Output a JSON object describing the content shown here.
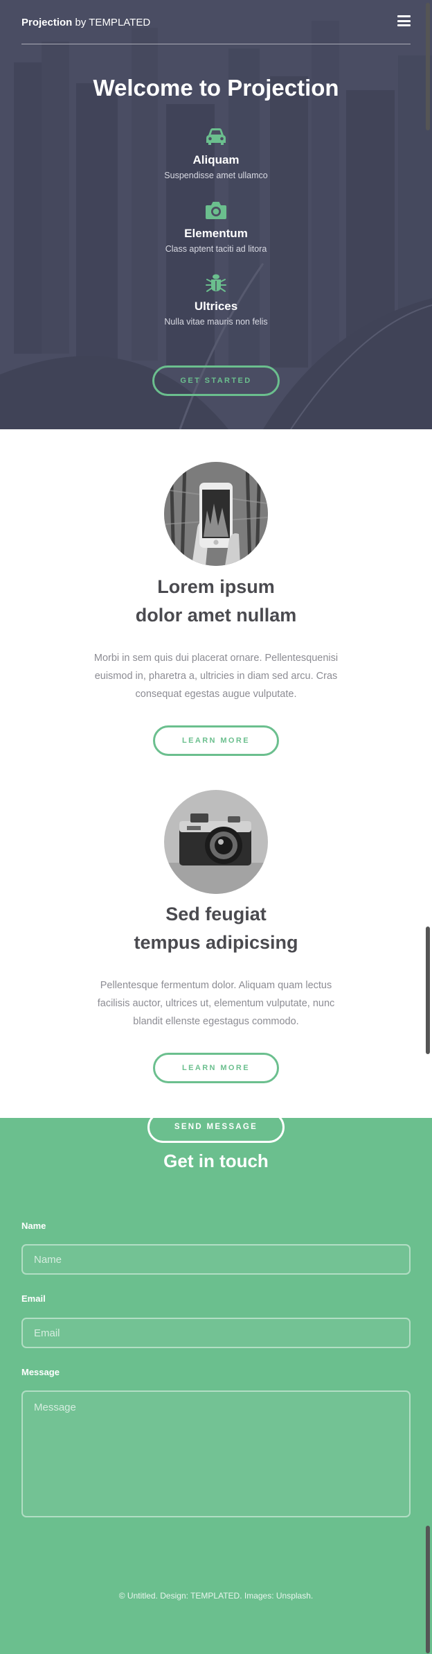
{
  "header": {
    "brand_main": "Projection",
    "brand_by": "by TEMPLATED",
    "menu_icon": "hamburger-menu-icon"
  },
  "hero": {
    "title": "Welcome to Projection",
    "features": [
      {
        "icon": "car-icon",
        "title": "Aliquam",
        "subtitle": "Suspendisse amet ullamco"
      },
      {
        "icon": "camera-icon",
        "title": "Elementum",
        "subtitle": "Class aptent taciti ad litora"
      },
      {
        "icon": "bug-icon",
        "title": "Ultrices",
        "subtitle": "Nulla vitae mauris non felis"
      }
    ],
    "cta_label": "GET STARTED"
  },
  "spotlights": [
    {
      "title_line1": "Lorem ipsum",
      "title_line2": "dolor amet nullam",
      "text": "Morbi in sem quis dui placerat ornare. Pellentesquenisi euismod in, pharetra a, ultricies in diam sed arcu. Cras consequat egestas augue vulputate.",
      "button_label": "LEARN MORE"
    },
    {
      "title_line1": "Sed feugiat",
      "title_line2": "tempus adipicsing",
      "text": "Pellentesque fermentum dolor. Aliquam quam lectus facilisis auctor, ultrices ut, elementum vulputate, nunc blandit ellenste egestagus commodo.",
      "button_label": "LEARN MORE"
    }
  ],
  "contact": {
    "title": "Get in touch",
    "name_label": "Name",
    "name_placeholder": "Name",
    "email_label": "Email",
    "email_placeholder": "Email",
    "message_label": "Message",
    "message_placeholder": "Message",
    "send_label": "SEND MESSAGE"
  },
  "footer": {
    "copyright": "© Untitled. Design: TEMPLATED. Images: Unsplash."
  },
  "colors": {
    "accent": "#6bbf8e",
    "hero_overlay": "#4a4c5f",
    "heading_text": "#4a4a4f",
    "body_text": "#8c8c93"
  }
}
